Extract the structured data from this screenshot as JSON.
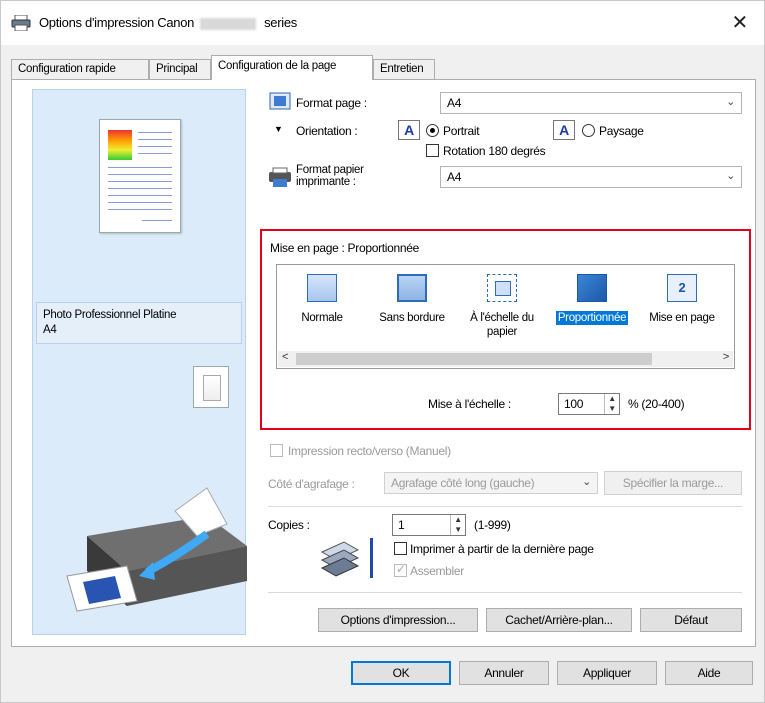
{
  "window": {
    "title_prefix": "Options d'impression Canon",
    "title_suffix": "series",
    "close_glyph": "✕"
  },
  "tabs": [
    {
      "label": "Configuration rapide"
    },
    {
      "label": "Principal"
    },
    {
      "label": "Configuration de la page"
    },
    {
      "label": "Entretien"
    }
  ],
  "preview": {
    "media_line1": "Photo Professionnel Platine",
    "media_line2": "A4"
  },
  "page_setup": {
    "page_size_label": "Format page :",
    "page_size_value": "A4",
    "orientation_label": "Orientation :",
    "portrait_label": "Portrait",
    "landscape_label": "Paysage",
    "rotate_label": "Rotation 180 degrés",
    "printer_paper_label_1": "Format papier",
    "printer_paper_label_2": "imprimante :",
    "printer_paper_value": "A4",
    "orientation_glyph": "A"
  },
  "layout": {
    "heading": "Mise en page :  Proportionnée",
    "items": [
      {
        "label": "Normale"
      },
      {
        "label": "Sans bordure"
      },
      {
        "label": "À l'échelle du papier"
      },
      {
        "label": "Proportionnée"
      },
      {
        "label": "Mise en page"
      }
    ],
    "pages_glyph": "2",
    "scroll_left": "<",
    "scroll_right": ">",
    "scaling_label": "Mise à l'échelle :",
    "scaling_value": "100",
    "scaling_range": "% (20-400)"
  },
  "duplex": {
    "label": "Impression recto/verso (Manuel)",
    "staple_label": "Côté d'agrafage :",
    "staple_value": "Agrafage côté long (gauche)",
    "margin_button": "Spécifier la marge..."
  },
  "copies": {
    "label": "Copies :",
    "value": "1",
    "range": "(1-999)",
    "reverse_label": "Imprimer à partir de la dernière page",
    "collate_label": "Assembler"
  },
  "panel_buttons": {
    "print_options": "Options d'impression...",
    "stamp": "Cachet/Arrière-plan...",
    "defaults": "Défaut"
  },
  "dialog_buttons": {
    "ok": "OK",
    "cancel": "Annuler",
    "apply": "Appliquer",
    "help": "Aide"
  },
  "colors": {
    "highlight_border": "#e3001b",
    "selection": "#0078d7",
    "preview_bg": "#dcebf9"
  }
}
